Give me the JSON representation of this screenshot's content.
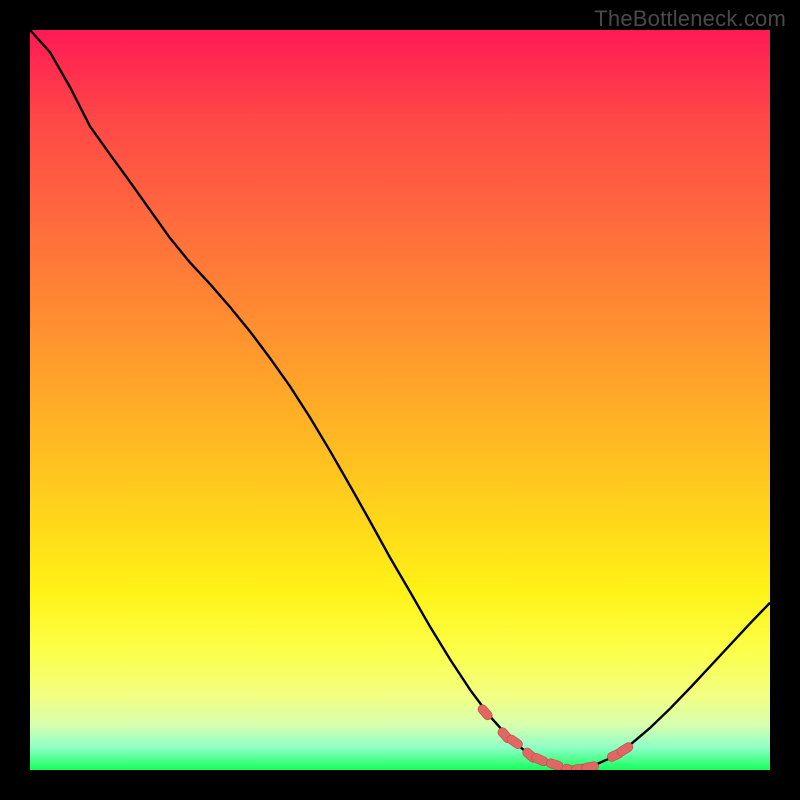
{
  "attribution": "TheBottleneck.com",
  "colors": {
    "background": "#000000",
    "gradient_top": "#ff1a55",
    "gradient_bottom": "#15ff5d",
    "curve_stroke": "#000000",
    "marker_fill": "#e06763",
    "marker_stroke": "#bb4a47"
  },
  "chart_data": {
    "type": "line",
    "title": "",
    "xlabel": "",
    "ylabel": "",
    "xlim": [
      0,
      100
    ],
    "ylim": [
      0,
      100
    ],
    "x": [
      0,
      2.7,
      5.4,
      8.1,
      10.8,
      13.5,
      16.2,
      18.9,
      21.6,
      24.3,
      27.0,
      29.7,
      32.4,
      35.1,
      37.8,
      40.5,
      43.2,
      45.9,
      48.6,
      51.4,
      54.1,
      56.8,
      59.5,
      62.2,
      64.9,
      67.6,
      70.3,
      73.0,
      75.7,
      78.4,
      81.1,
      83.8,
      86.5,
      89.2,
      91.9,
      94.6,
      97.3,
      100
    ],
    "y": [
      100,
      97.0,
      92.3,
      87.0,
      83.2,
      79.5,
      75.7,
      71.9,
      68.6,
      65.7,
      62.6,
      59.3,
      55.7,
      51.9,
      47.7,
      43.2,
      38.5,
      33.7,
      28.8,
      24.0,
      19.3,
      14.9,
      10.8,
      7.2,
      4.2,
      2.0,
      0.6,
      0.0,
      0.4,
      1.6,
      3.4,
      5.7,
      8.3,
      11.1,
      14.0,
      16.9,
      19.8,
      22.6
    ],
    "markers": {
      "x": [
        61.5,
        64.2,
        65.5,
        67.6,
        68.9,
        70.9,
        73.0,
        74.3,
        75.7,
        79.1,
        80.4
      ],
      "y": [
        7.8,
        4.7,
        3.8,
        2.0,
        1.4,
        0.74,
        0.0,
        0.14,
        0.41,
        2.0,
        2.8
      ]
    }
  }
}
